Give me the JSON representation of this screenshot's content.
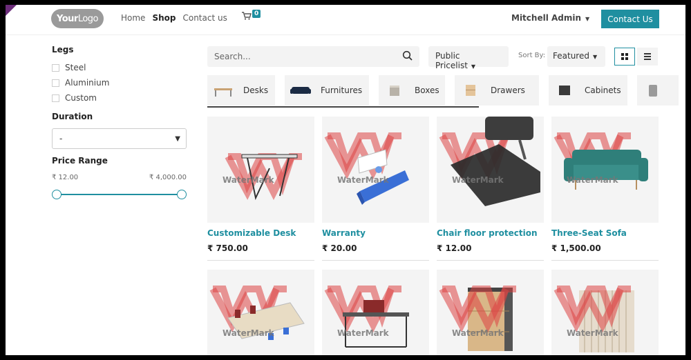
{
  "header": {
    "logo_bold": "Your",
    "logo_light": "Logo",
    "nav": [
      {
        "label": "Home"
      },
      {
        "label": "Shop"
      },
      {
        "label": "Contact us"
      }
    ],
    "cart_count": "0",
    "user": "Mitchell Admin",
    "contact_button": "Contact Us",
    "accent_color": "#1f8fa0"
  },
  "sidebar": {
    "legs_title": "Legs",
    "legs": [
      "Steel",
      "Aluminium",
      "Custom"
    ],
    "duration_title": "Duration",
    "duration_value": "-",
    "price_title": "Price Range",
    "price_min": "₹ 12.00",
    "price_max": "₹ 4,000.00"
  },
  "toolbar": {
    "search_placeholder": "Search...",
    "pricelist": "Public Pricelist",
    "sort_label": "Sort By:",
    "sort_value": "Featured"
  },
  "categories": [
    "Desks",
    "Furnitures",
    "Boxes",
    "Drawers",
    "Cabinets"
  ],
  "products": [
    {
      "name": "Customizable Desk",
      "price": "₹ 750.00"
    },
    {
      "name": "Warranty",
      "price": "₹ 20.00"
    },
    {
      "name": "Chair floor protection",
      "price": "₹ 12.00"
    },
    {
      "name": "Three-Seat Sofa",
      "price": "₹ 1,500.00"
    },
    {
      "name": "",
      "price": ""
    },
    {
      "name": "",
      "price": ""
    },
    {
      "name": "",
      "price": ""
    },
    {
      "name": "",
      "price": ""
    }
  ],
  "watermark_text": "WaterMark"
}
